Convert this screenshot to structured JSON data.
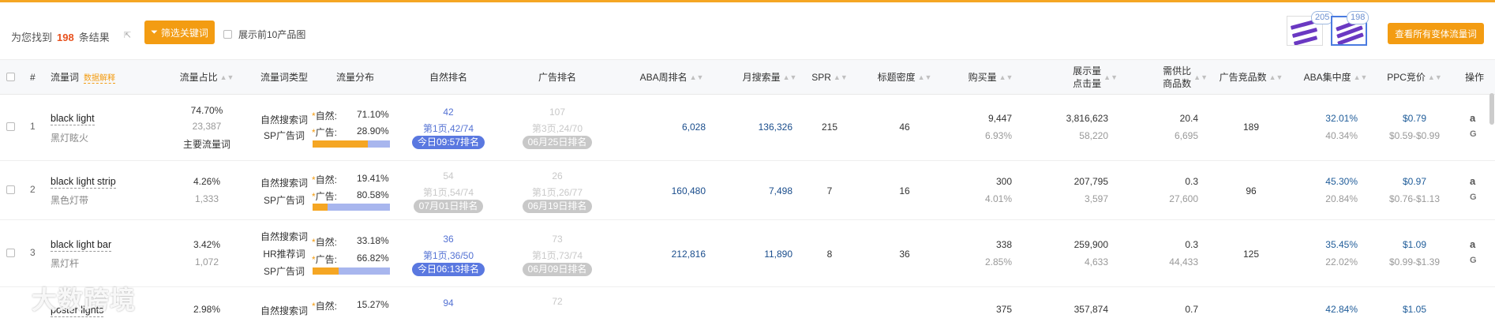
{
  "toolbar": {
    "result_prefix": "为您找到",
    "result_count": "198",
    "result_suffix": "条结果",
    "filter_button": "筛选关键词",
    "show_top10": "展示前10产品图",
    "thumb1_count": "205",
    "thumb2_count": "198",
    "variants_button": "查看所有变体流量词"
  },
  "colors": {
    "accent": "#f39c12",
    "pill_blue": "#5a78e0",
    "pill_grey": "#c8c8c8",
    "bar_orange": "#f5a623",
    "bar_blue": "#a8b6ee"
  },
  "headers": {
    "index": "#",
    "keyword": "流量词",
    "keyword_tag": "数据解释",
    "share": "流量占比",
    "type": "流量词类型",
    "distribution": "流量分布",
    "organic_rank": "自然排名",
    "ad_rank": "广告排名",
    "aba_week": "ABA周排名",
    "monthly_search": "月搜索量",
    "spr": "SPR",
    "title_density": "标题密度",
    "purchases": "购买量",
    "impressions_l1": "展示量",
    "impressions_l2": "点击量",
    "supply_l1": "需供比",
    "supply_l2": "商品数",
    "ad_competitors": "广告竞品数",
    "aba_concentration": "ABA集中度",
    "ppc": "PPC竞价",
    "action": "操作"
  },
  "rows": [
    {
      "index": "1",
      "kw": "black light",
      "kw_cn": "黑灯眩火",
      "share": "74.70%",
      "share_sub": "23,387",
      "share_tag": "主要流量词",
      "types": [
        "自然搜索词",
        "SP广告词"
      ],
      "organic_label": "自然:",
      "organic_pct": "71.10%",
      "ad_label": "广告:",
      "ad_pct": "28.90%",
      "organic_share": 0.711,
      "org_rank": "42",
      "org_page": "第1页,42/74",
      "org_time": "今日09:57排名",
      "ad_rank": "107",
      "ad_page": "第3页,24/70",
      "ad_time": "06月25日排名",
      "aba": "6,028",
      "monthly": "136,326",
      "spr": "215",
      "density": "46",
      "buy": "9,447",
      "buy_pct": "6.93%",
      "imp": "3,816,623",
      "clicks": "58,220",
      "ratio": "20.4",
      "products": "6,695",
      "ad_comp": "189",
      "conc": "32.01%",
      "conc2": "40.34%",
      "ppc": "$0.79",
      "ppc_range": "$0.59-$0.99"
    },
    {
      "index": "2",
      "kw": "black light strip",
      "kw_cn": "黑色灯带",
      "share": "4.26%",
      "share_sub": "1,333",
      "share_tag": "",
      "types": [
        "自然搜索词",
        "SP广告词"
      ],
      "organic_label": "自然:",
      "organic_pct": "19.41%",
      "ad_label": "广告:",
      "ad_pct": "80.58%",
      "organic_share": 0.194,
      "org_rank": "54",
      "org_page": "第1页,54/74",
      "org_time": "07月01日排名",
      "ad_rank": "26",
      "ad_page": "第1页,26/77",
      "ad_time": "06月19日排名",
      "aba": "160,480",
      "monthly": "7,498",
      "spr": "7",
      "density": "16",
      "buy": "300",
      "buy_pct": "4.01%",
      "imp": "207,795",
      "clicks": "3,597",
      "ratio": "0.3",
      "products": "27,600",
      "ad_comp": "96",
      "conc": "45.30%",
      "conc2": "20.84%",
      "ppc": "$0.97",
      "ppc_range": "$0.76-$1.13"
    },
    {
      "index": "3",
      "kw": "black light bar",
      "kw_cn": "黑灯杆",
      "share": "3.42%",
      "share_sub": "1,072",
      "share_tag": "",
      "types": [
        "自然搜索词",
        "HR推荐词",
        "SP广告词"
      ],
      "organic_label": "自然:",
      "organic_pct": "33.18%",
      "ad_label": "广告:",
      "ad_pct": "66.82%",
      "organic_share": 0.332,
      "org_rank": "36",
      "org_page": "第1页,36/50",
      "org_time": "今日06:13排名",
      "ad_rank": "73",
      "ad_page": "第1页,73/74",
      "ad_time": "06月09日排名",
      "aba": "212,816",
      "monthly": "11,890",
      "spr": "8",
      "density": "36",
      "buy": "338",
      "buy_pct": "2.85%",
      "imp": "259,900",
      "clicks": "4,633",
      "ratio": "0.3",
      "products": "44,433",
      "ad_comp": "125",
      "conc": "35.45%",
      "conc2": "22.02%",
      "ppc": "$1.09",
      "ppc_range": "$0.99-$1.39"
    },
    {
      "index": "",
      "kw": "poster lights",
      "share": "2.98%",
      "type1": "自然搜索词",
      "organic_label": "自然:",
      "organic_pct": "15.27%",
      "org_rank": "94",
      "ad_rank": "72",
      "buy": "375",
      "imp": "357,874",
      "ratio": "0.7",
      "conc": "42.84%",
      "ppc": "$1.05"
    }
  ],
  "actions": {
    "amazon": "a",
    "google": "G"
  },
  "watermark": "大数跨境"
}
